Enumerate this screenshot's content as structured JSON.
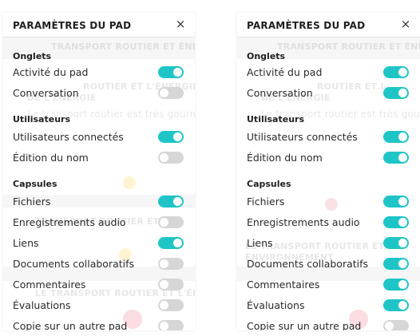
{
  "panels": [
    {
      "title": "PARAMÈTRES DU PAD",
      "close": "×",
      "sections": [
        {
          "label": "Onglets",
          "items": [
            {
              "label": "Activité du pad",
              "on": true
            },
            {
              "label": "Conversation",
              "on": false
            }
          ]
        },
        {
          "label": "Utilisateurs",
          "items": [
            {
              "label": "Utilisateurs connectés",
              "on": true
            },
            {
              "label": "Édition du nom",
              "on": false
            }
          ]
        },
        {
          "label": "Capsules",
          "items": [
            {
              "label": "Fichiers",
              "on": true
            },
            {
              "label": "Enregistrements audio",
              "on": false
            },
            {
              "label": "Liens",
              "on": true
            },
            {
              "label": "Documents collaboratifs",
              "on": false
            },
            {
              "label": "Commentaires",
              "on": false
            },
            {
              "label": "Évaluations",
              "on": false
            },
            {
              "label": "Copie sur un autre pad",
              "on": false
            }
          ]
        }
      ]
    },
    {
      "title": "PARAMÈTRES DU PAD",
      "close": "×",
      "sections": [
        {
          "label": "Onglets",
          "items": [
            {
              "label": "Activité du pad",
              "on": true
            },
            {
              "label": "Conversation",
              "on": true
            }
          ]
        },
        {
          "label": "Utilisateurs",
          "items": [
            {
              "label": "Utilisateurs connectés",
              "on": true
            },
            {
              "label": "Édition du nom",
              "on": true
            }
          ]
        },
        {
          "label": "Capsules",
          "items": [
            {
              "label": "Fichiers",
              "on": true
            },
            {
              "label": "Enregistrements audio",
              "on": true
            },
            {
              "label": "Liens",
              "on": true
            },
            {
              "label": "Documents collaboratifs",
              "on": true
            },
            {
              "label": "Commentaires",
              "on": true
            },
            {
              "label": "Évaluations",
              "on": true
            },
            {
              "label": "Copie sur un autre pad",
              "on": false
            }
          ]
        }
      ]
    }
  ],
  "colors": {
    "toggle_on": "#1fc5c6",
    "toggle_off": "#d6d6d6"
  }
}
